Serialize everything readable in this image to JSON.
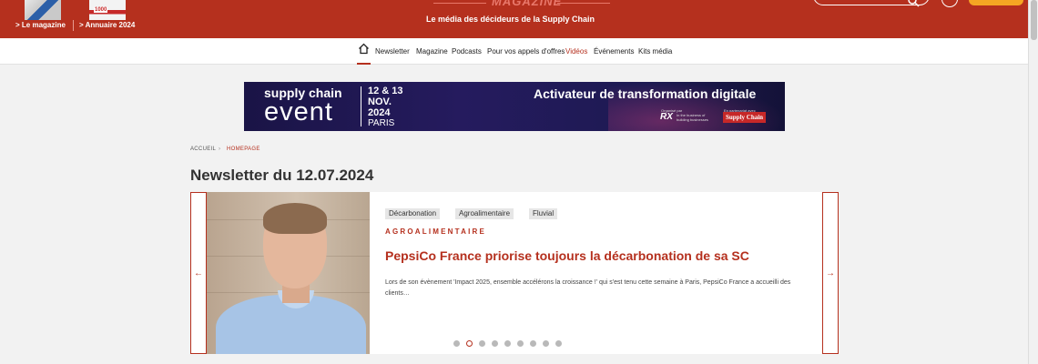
{
  "header": {
    "magazine_thumb_text": "1000",
    "link_magazine": "> Le magazine",
    "link_annuaire": "> Annuaire 2024",
    "brand_word": "MAGAZINE",
    "tagline": "Le média des décideurs de la Supply Chain",
    "colors": {
      "brand": "#b5301e",
      "accent": "#f5a623"
    }
  },
  "nav": {
    "home_icon": "home-icon",
    "items": [
      "Newsletter",
      "Magazine",
      "Podcasts",
      "Pour vos appels d'offres",
      "Vidéos",
      "Événements",
      "Kits média"
    ],
    "active": "Vidéos"
  },
  "banner": {
    "line1": "supply chain",
    "line2": "event",
    "date_line1": "12 & 13",
    "date_line2": "NOV.",
    "date_line3": "2024",
    "date_line4": "PARIS",
    "headline": "Activateur de transformation digitale",
    "organizer_label": "Organisé par",
    "organizer": "RX",
    "organizer_sub": "In the business of building businesses",
    "partner_label": "En partenariat avec",
    "partner": "Supply Chain"
  },
  "breadcrumb": {
    "home": "ACCUEIL",
    "separator": "›",
    "current": "HOMEPAGE"
  },
  "page_title": "Newsletter du 12.07.2024",
  "carousel": {
    "prev_label": "←",
    "next_label": "→",
    "tags": [
      "Décarbonation",
      "Agroalimentaire",
      "Fluvial"
    ],
    "category": "AGROALIMENTAIRE",
    "title": "PepsiCo France priorise toujours la décarbonation de sa SC",
    "excerpt": "Lors de son évènement 'Impact 2025, ensemble accélérons la croissance !' qui s'est tenu cette semaine à Paris, PepsiCo France a accueilli des clients…",
    "dots_total": 9,
    "active_dot": 2
  }
}
